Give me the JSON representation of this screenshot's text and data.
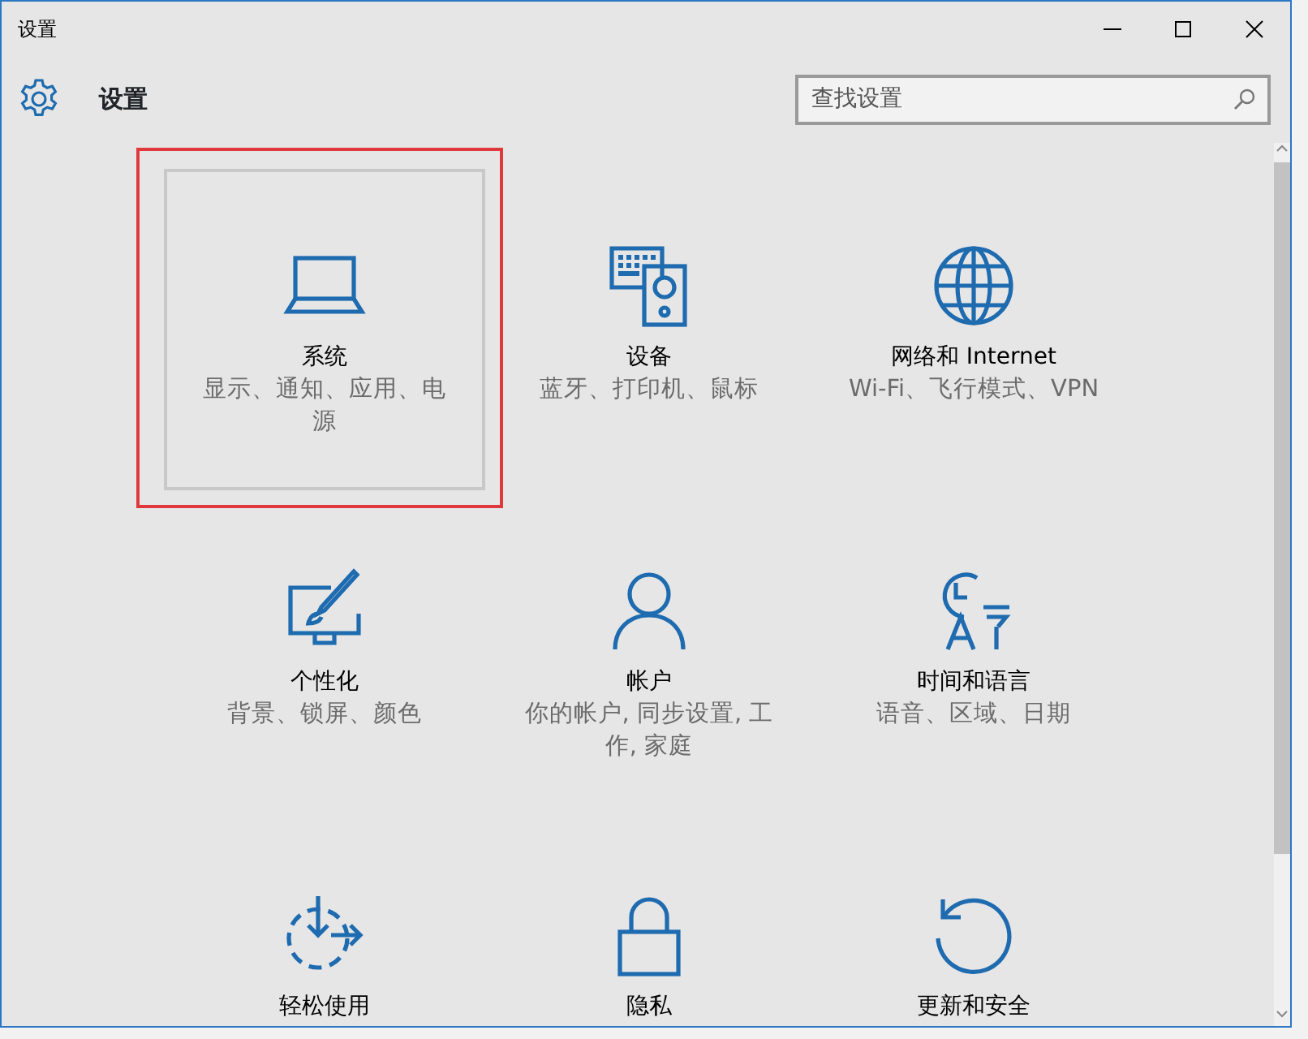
{
  "window": {
    "title": "设置"
  },
  "header": {
    "title": "设置",
    "search": {
      "placeholder": "查找设置"
    }
  },
  "tiles": [
    {
      "title": "系统",
      "description": "显示、通知、应用、电源",
      "focused": true,
      "annotated": true
    },
    {
      "title": "设备",
      "description": "蓝牙、打印机、鼠标",
      "focused": false,
      "annotated": false
    },
    {
      "title": "网络和 Internet",
      "description": "Wi-Fi、飞行模式、VPN",
      "focused": false,
      "annotated": false
    },
    {
      "title": "个性化",
      "description": "背景、锁屏、颜色",
      "focused": false,
      "annotated": false
    },
    {
      "title": "帐户",
      "description": "你的帐户, 同步设置, 工作, 家庭",
      "focused": false,
      "annotated": false
    },
    {
      "title": "时间和语言",
      "description": "语音、区域、日期",
      "focused": false,
      "annotated": false
    },
    {
      "title": "轻松使用",
      "focused": false,
      "annotated": false
    },
    {
      "title": "隐私",
      "focused": false,
      "annotated": false
    },
    {
      "title": "更新和安全",
      "focused": false,
      "annotated": false
    }
  ]
}
